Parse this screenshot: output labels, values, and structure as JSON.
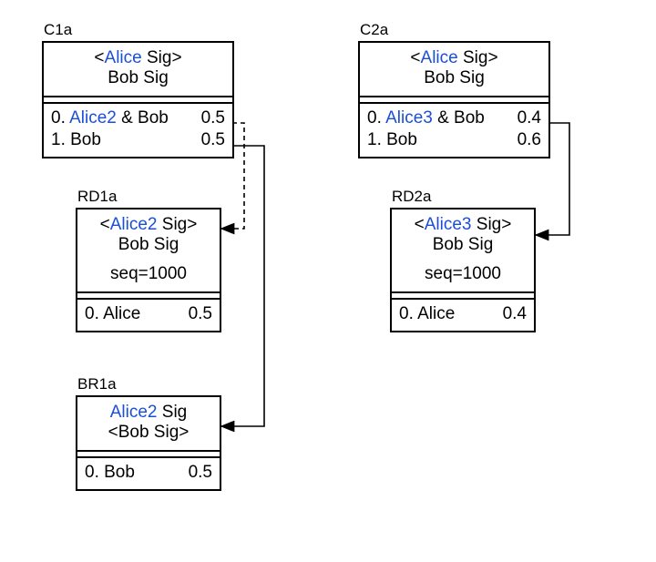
{
  "blue_color": "#1a4fd6",
  "boxes": {
    "c1a": {
      "label": "C1a",
      "sig1_pre": "<",
      "sig1_name": "Alice",
      "sig1_post": " Sig>",
      "sig2": "Bob Sig",
      "out0_idx": "0. ",
      "out0_party_blue": "Alice2",
      "out0_party_rest": " & Bob",
      "out0_amt": "0.5",
      "out1_idx": "1. ",
      "out1_party": "Bob",
      "out1_amt": "0.5"
    },
    "c2a": {
      "label": "C2a",
      "sig1_pre": "<",
      "sig1_name": "Alice",
      "sig1_post": " Sig>",
      "sig2": "Bob Sig",
      "out0_idx": "0. ",
      "out0_party_blue": "Alice3",
      "out0_party_rest": " & Bob",
      "out0_amt": "0.4",
      "out1_idx": "1. ",
      "out1_party": "Bob",
      "out1_amt": "0.6"
    },
    "rd1a": {
      "label": "RD1a",
      "sig1_pre": "<",
      "sig1_name": "Alice2",
      "sig1_post": " Sig>",
      "sig2": "Bob Sig",
      "seq": "seq=1000",
      "out0_idx": "0. ",
      "out0_party": "Alice",
      "out0_amt": "0.5"
    },
    "rd2a": {
      "label": "RD2a",
      "sig1_pre": "<",
      "sig1_name": "Alice3",
      "sig1_post": " Sig>",
      "sig2": "Bob Sig",
      "seq": "seq=1000",
      "out0_idx": "0. ",
      "out0_party": "Alice",
      "out0_amt": "0.4"
    },
    "br1a": {
      "label": "BR1a",
      "sig1_name": "Alice2",
      "sig1_post": " Sig",
      "sig2": "<Bob Sig>",
      "out0_idx": "0. ",
      "out0_party": "Bob",
      "out0_amt": "0.5"
    }
  }
}
